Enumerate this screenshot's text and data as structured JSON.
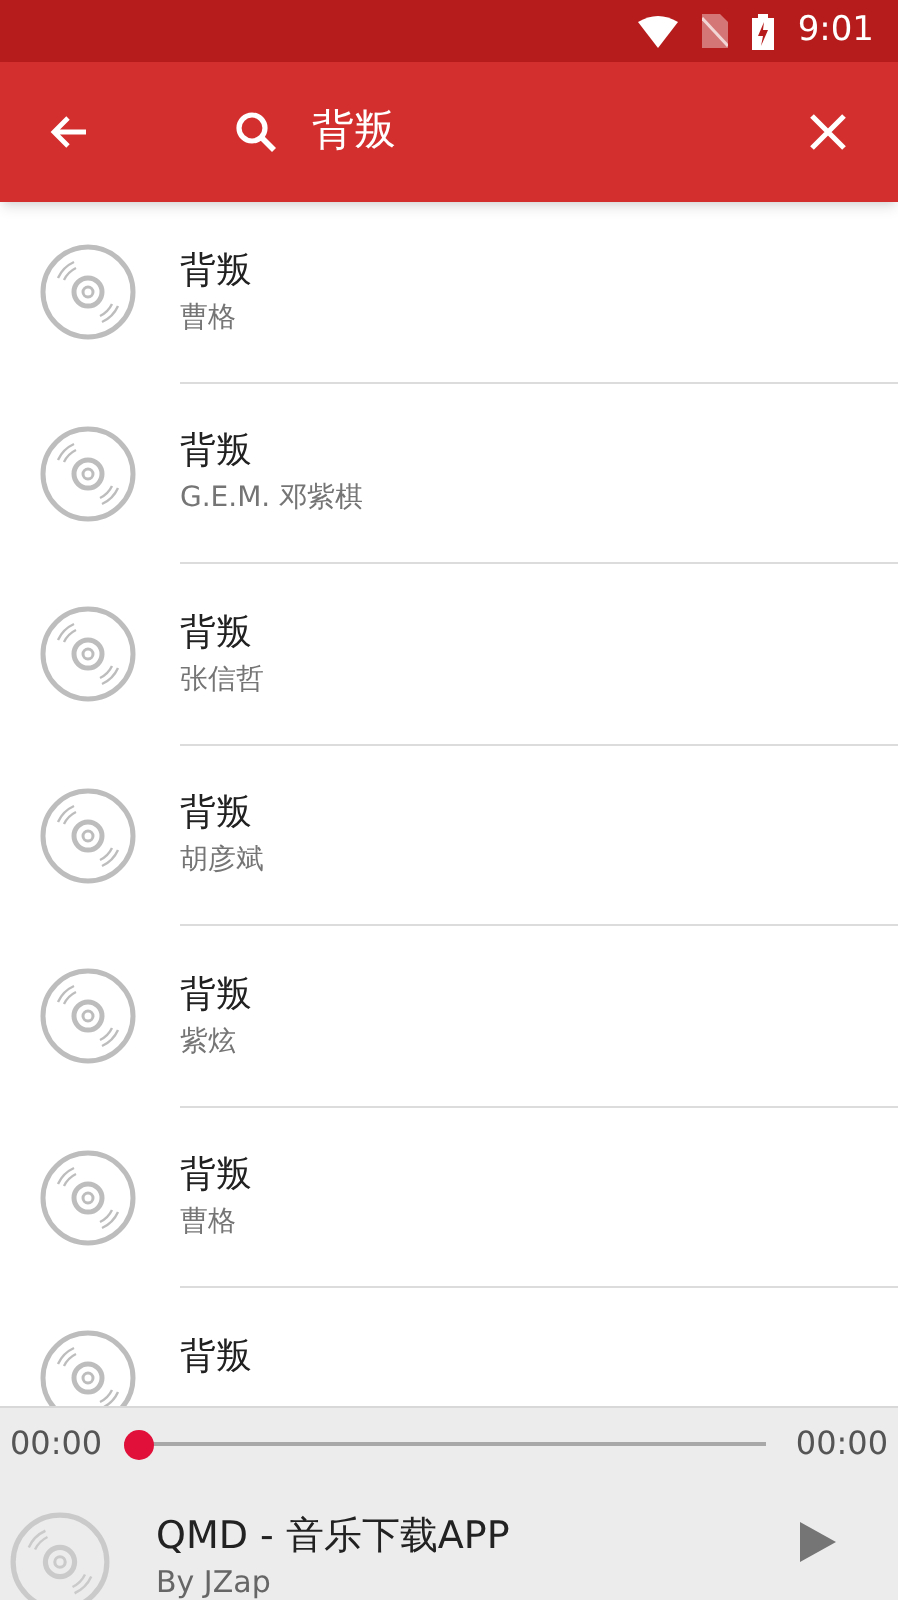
{
  "status_bar": {
    "time": "9:01"
  },
  "app_bar": {
    "query": "背叛"
  },
  "results": [
    {
      "title": "背叛",
      "artist": "曹格"
    },
    {
      "title": "背叛",
      "artist": "G.E.M. 邓紫棋"
    },
    {
      "title": "背叛",
      "artist": "张信哲"
    },
    {
      "title": "背叛",
      "artist": "胡彦斌"
    },
    {
      "title": "背叛",
      "artist": "紫炫"
    },
    {
      "title": "背叛",
      "artist": "曹格"
    },
    {
      "title": "背叛"
    }
  ],
  "player": {
    "elapsed": "00:00",
    "duration": "00:00",
    "level": 0,
    "title": "QMD - 音乐下载APP",
    "subtitle": "By JZap"
  }
}
